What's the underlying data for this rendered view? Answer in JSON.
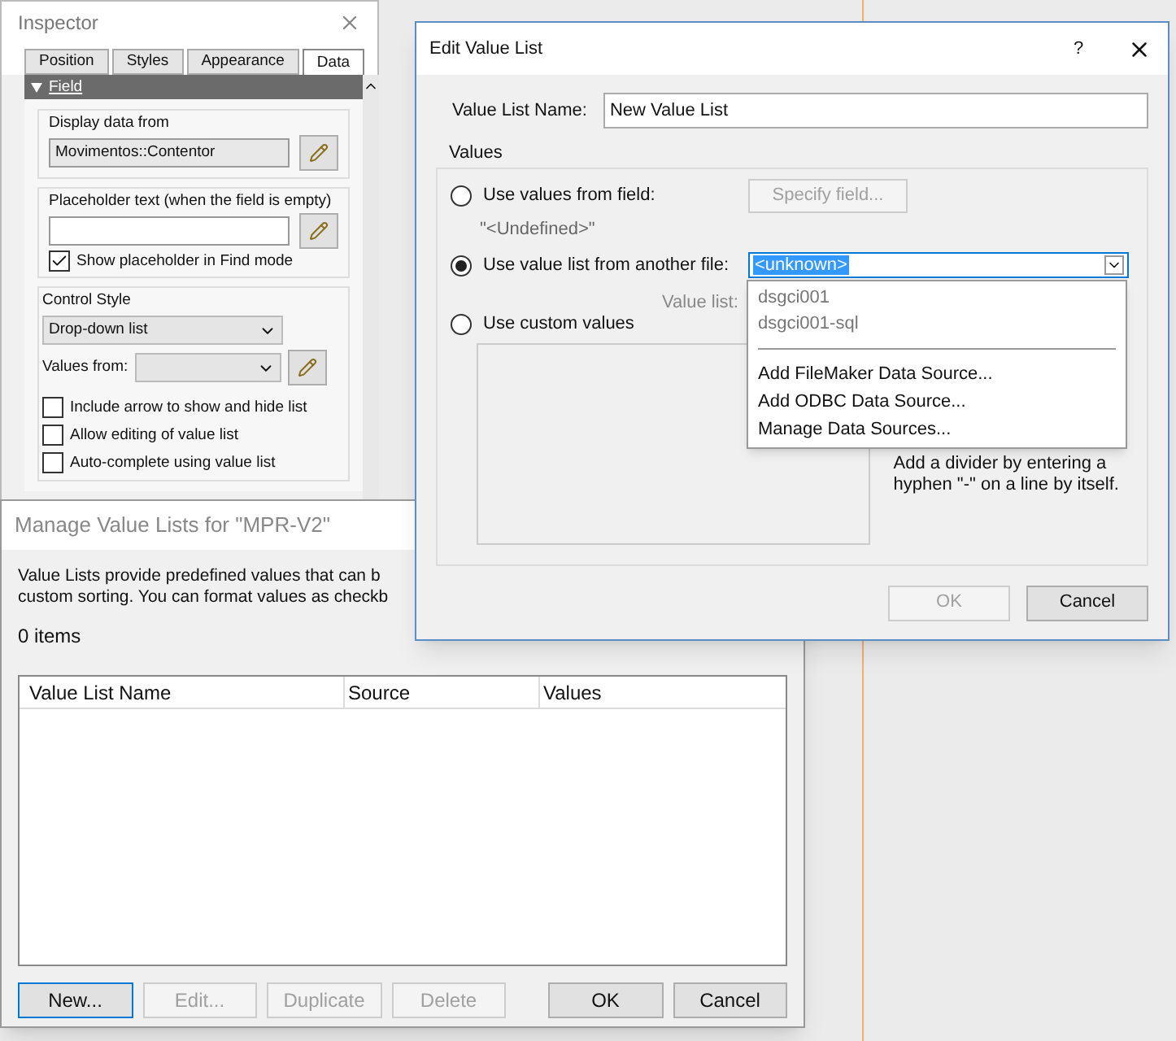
{
  "inspector": {
    "title": "Inspector",
    "tabs": [
      {
        "label": "Position",
        "selected": false
      },
      {
        "label": "Styles",
        "selected": false
      },
      {
        "label": "Appearance",
        "selected": false
      },
      {
        "label": "Data",
        "selected": true
      }
    ],
    "section": {
      "title": "Field",
      "expanded": true
    },
    "display_data_from": {
      "label": "Display data from",
      "value": "Movimentos::Contentor"
    },
    "placeholder_text": {
      "label": "Placeholder text (when the field is empty)"
    },
    "show_placeholder": {
      "label": "Show placeholder in Find mode",
      "checked": true
    },
    "control_style": {
      "label": "Control Style",
      "value": "Drop-down list"
    },
    "values_from": {
      "label": "Values from:"
    },
    "options": [
      {
        "label": "Include arrow to show and hide list",
        "checked": false
      },
      {
        "label": "Allow editing of value list",
        "checked": false
      },
      {
        "label": "Auto-complete using value list",
        "checked": false
      }
    ]
  },
  "manage_dialog": {
    "title": "Manage Value Lists for \"MPR-V2\"",
    "description": [
      "Value Lists provide predefined values that can b",
      "custom sorting. You can format values as checkb"
    ],
    "count": "0 items",
    "columns": [
      "Value List Name",
      "Source",
      "Values"
    ],
    "buttons": [
      {
        "label": "New...",
        "disabled": false,
        "focused": true
      },
      {
        "label": "Edit...",
        "disabled": true,
        "focused": false
      },
      {
        "label": "Duplicate",
        "disabled": true,
        "focused": false
      },
      {
        "label": "Delete",
        "disabled": true,
        "focused": false
      },
      {
        "label": "OK",
        "disabled": false,
        "focused": false
      },
      {
        "label": "Cancel",
        "disabled": false,
        "focused": false
      }
    ]
  },
  "edit_dialog": {
    "title": "Edit Value List",
    "help": "?",
    "name_label": "Value List Name:",
    "name_value": "New Value List",
    "group_label": "Values",
    "from_field": {
      "label": "Use values from field:",
      "selected": false,
      "button": "Specify field...",
      "field": "\"<Undefined>\""
    },
    "from_file": {
      "label": "Use value list from another file:",
      "selected": true,
      "combo_value": "<unknown>",
      "value_list_label": "Value list:"
    },
    "custom": {
      "label": "Use custom values",
      "selected": false
    },
    "hint": "Add a divider by entering a hyphen \"-\" on a line by itself.",
    "buttons": [
      {
        "label": "OK",
        "disabled": true
      },
      {
        "label": "Cancel",
        "disabled": false
      }
    ],
    "menu": [
      {
        "kind": "source",
        "label": "dsgci001"
      },
      {
        "kind": "source",
        "label": "dsgci001-sql"
      },
      {
        "kind": "divider"
      },
      {
        "kind": "action",
        "label": "Add FileMaker Data Source..."
      },
      {
        "kind": "action",
        "label": "Add ODBC Data Source..."
      },
      {
        "kind": "action",
        "label": "Manage Data Sources..."
      }
    ]
  }
}
